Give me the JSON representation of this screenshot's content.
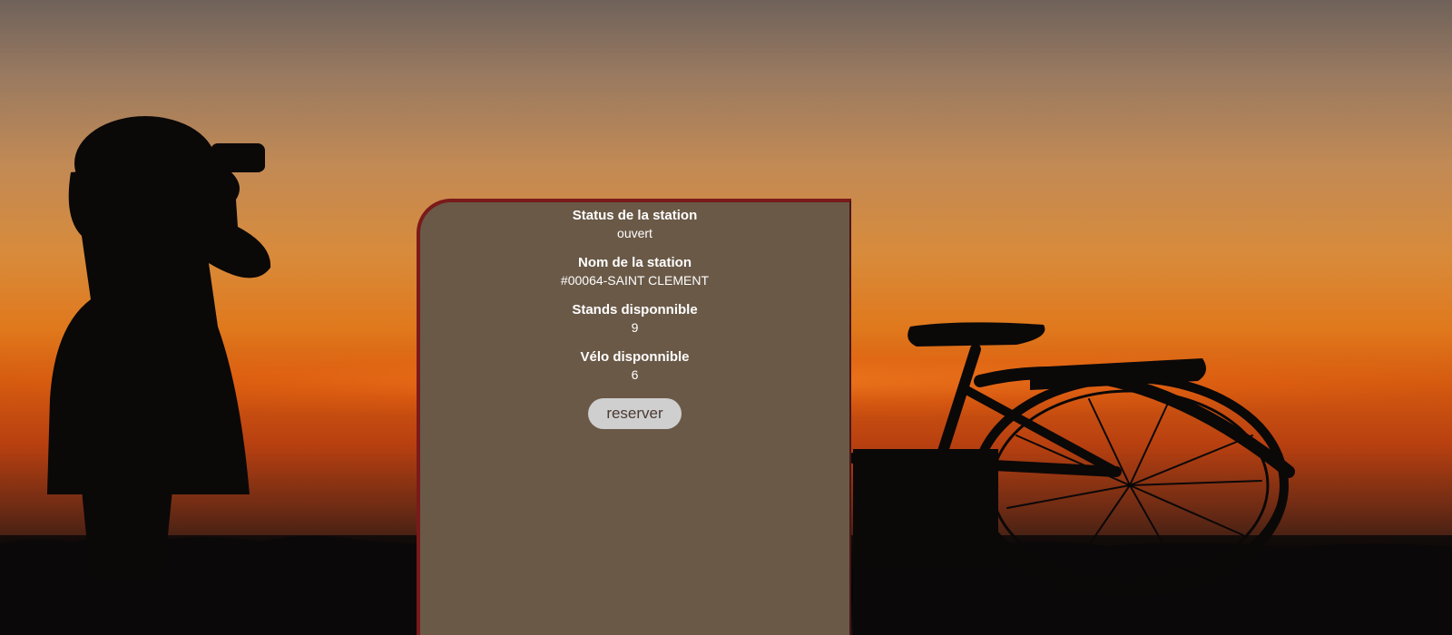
{
  "station": {
    "status_label": "Status de la station",
    "status_value": "ouvert",
    "name_label": "Nom de la station",
    "name_value": "#00064-SAINT CLEMENT",
    "stands_label": "Stands disponnible",
    "stands_value": "9",
    "bikes_label": "Vélo disponnible",
    "bikes_value": "6",
    "reserve_label": "reserver"
  },
  "theme": {
    "panel_bg": "#6a5947",
    "panel_border": "#7a1a1a",
    "button_bg": "#cfcfcf"
  }
}
